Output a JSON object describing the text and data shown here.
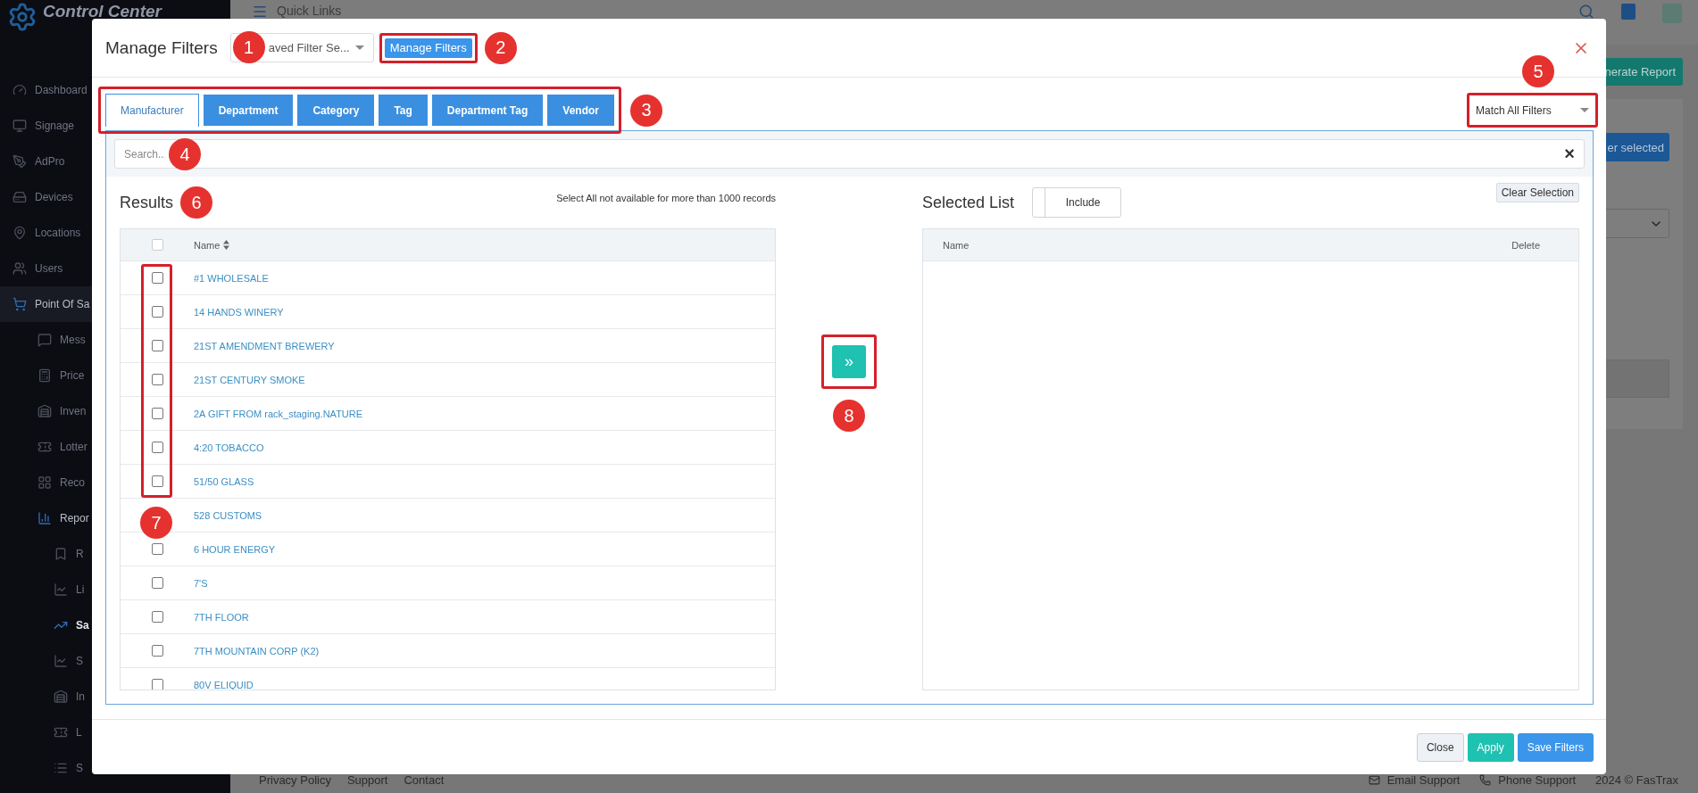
{
  "sidebar": {
    "logo": "Control Center",
    "items": [
      {
        "label": "Dashboard",
        "selected": false
      },
      {
        "label": "Signage",
        "selected": false
      },
      {
        "label": "AdPro",
        "selected": false
      },
      {
        "label": "Devices",
        "selected": false
      },
      {
        "label": "Locations",
        "selected": false
      },
      {
        "label": "Users",
        "selected": false
      },
      {
        "label": "Point Of Sa",
        "selected": false,
        "expanded": true,
        "children": [
          {
            "label": "Mess",
            "selected": false
          },
          {
            "label": "Price",
            "selected": false
          },
          {
            "label": "Inven",
            "selected": false
          },
          {
            "label": "Lotter",
            "selected": false
          },
          {
            "label": "Reco",
            "selected": false
          },
          {
            "label": "Repor",
            "selected": false,
            "expanded": true,
            "children": [
              {
                "label": "R",
                "selected": false
              },
              {
                "label": "Li",
                "selected": false
              },
              {
                "label": "Sa",
                "selected": true
              },
              {
                "label": "S",
                "selected": false
              },
              {
                "label": "In",
                "selected": false
              },
              {
                "label": "L",
                "selected": false
              },
              {
                "label": "S",
                "selected": false
              }
            ]
          }
        ]
      }
    ]
  },
  "topbar": {
    "title": "Quick Links"
  },
  "background_panel": {
    "generate_button": "nerate Report",
    "filter_button": "er selected"
  },
  "footer": {
    "links": [
      "Privacy Policy",
      "Support",
      "Contact"
    ],
    "email": "Email Support",
    "phone": "Phone Support",
    "copyright": "2024 © FasTrax"
  },
  "modal": {
    "title": "Manage Filters",
    "saved_filter": {
      "value": "aved Filter Se..."
    },
    "manage_button": "Manage Filters",
    "tabs": [
      {
        "label": "Manufacturer",
        "selected": true
      },
      {
        "label": "Department",
        "selected": false
      },
      {
        "label": "Category",
        "selected": false
      },
      {
        "label": "Tag",
        "selected": false
      },
      {
        "label": "Department Tag",
        "selected": false
      },
      {
        "label": "Vendor",
        "selected": false
      }
    ],
    "match_mode": {
      "value": "Match All Filters"
    },
    "search": {
      "placeholder": "Search...",
      "clear": "×"
    },
    "results": {
      "title": "Results",
      "note": "Select All not available for more than 1000 records",
      "select_all": {
        "checked": false,
        "disabled": true
      },
      "column": "Name",
      "rows": [
        {
          "name": "#1 WHOLESALE",
          "checked": false
        },
        {
          "name": "14 HANDS WINERY",
          "checked": false
        },
        {
          "name": "21ST AMENDMENT BREWERY",
          "checked": false
        },
        {
          "name": "21ST CENTURY SMOKE",
          "checked": false
        },
        {
          "name": "2A GIFT FROM rack_staging.NATURE",
          "checked": false
        },
        {
          "name": "4:20 TOBACCO",
          "checked": false
        },
        {
          "name": "51/50 GLASS",
          "checked": false
        },
        {
          "name": "528 CUSTOMS"
        },
        {
          "name": "6 HOUR ENERGY",
          "checked": false
        },
        {
          "name": "7'S",
          "checked": false
        },
        {
          "name": "7TH FLOOR",
          "checked": false
        },
        {
          "name": "7TH MOUNTAIN CORP (K2)",
          "checked": false
        },
        {
          "name": "80V ELIQUID",
          "checked": false
        }
      ]
    },
    "move_button": "»",
    "selected_list": {
      "title": "Selected List",
      "toggle": "Include",
      "clear_button": "Clear Selection",
      "columns": [
        "Name",
        "Delete"
      ]
    },
    "buttons": [
      {
        "label": "Close",
        "kind": "light"
      },
      {
        "label": "Apply",
        "kind": "teal"
      },
      {
        "label": "Save Filters",
        "kind": "primary"
      }
    ]
  },
  "annotations": [
    {
      "label": "1"
    },
    {
      "label": "2"
    },
    {
      "label": "3"
    },
    {
      "label": "4"
    },
    {
      "label": "5"
    },
    {
      "label": "6"
    },
    {
      "label": "7"
    },
    {
      "label": "8"
    }
  ]
}
